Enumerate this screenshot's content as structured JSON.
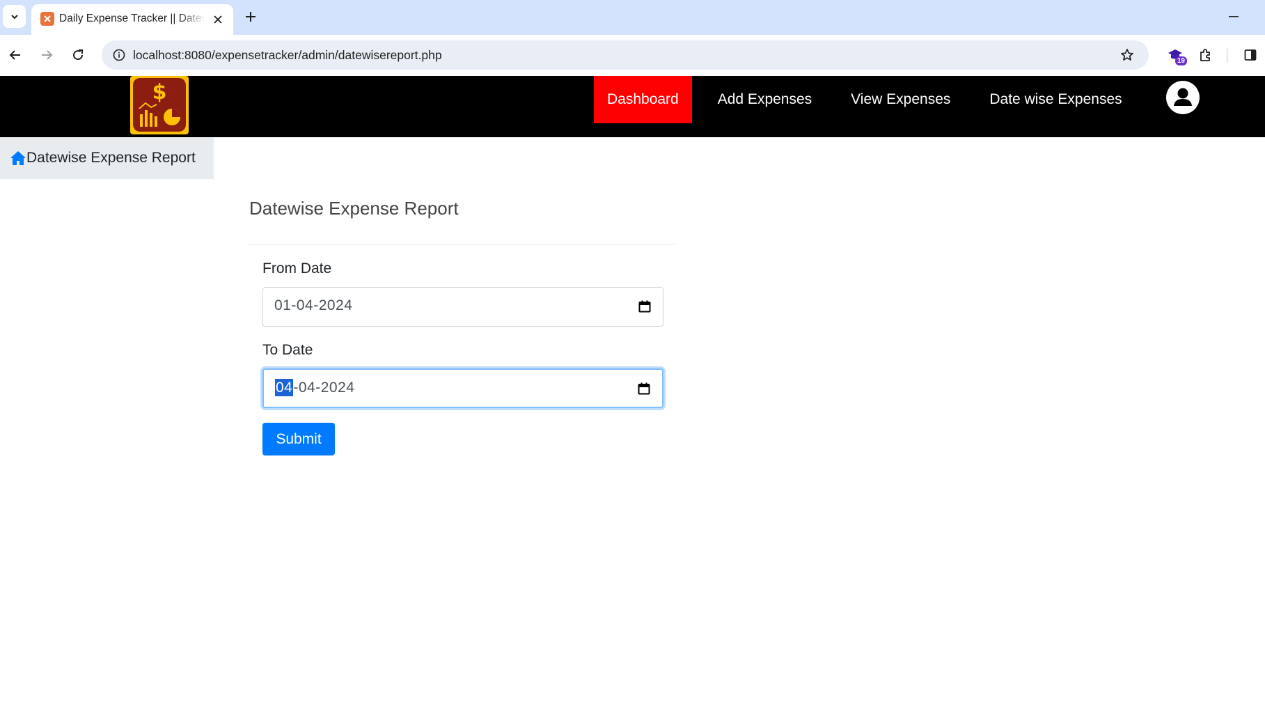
{
  "browser": {
    "tab_title": "Daily Expense Tracker || Datewise Expense Report",
    "url": "localhost:8080/expensetracker/admin/datewisereport.php",
    "extension_badge": "19"
  },
  "header": {
    "nav": [
      {
        "label": "Dashboard",
        "active": true
      },
      {
        "label": "Add Expenses",
        "active": false
      },
      {
        "label": "View Expenses",
        "active": false
      },
      {
        "label": "Date wise Expenses",
        "active": false
      }
    ],
    "active_color": "#ff0000"
  },
  "breadcrumb": {
    "label": "Datewise Expense Report"
  },
  "form": {
    "title": "Datewise Expense Report",
    "from_label": "From Date",
    "from_value": "01-04-2024",
    "to_label": "To Date",
    "to_value_selected_segment": "04",
    "to_value_rest": "-04-2024",
    "submit_label": "Submit"
  },
  "colors": {
    "primary": "#007bff",
    "header_bg": "#000000"
  }
}
